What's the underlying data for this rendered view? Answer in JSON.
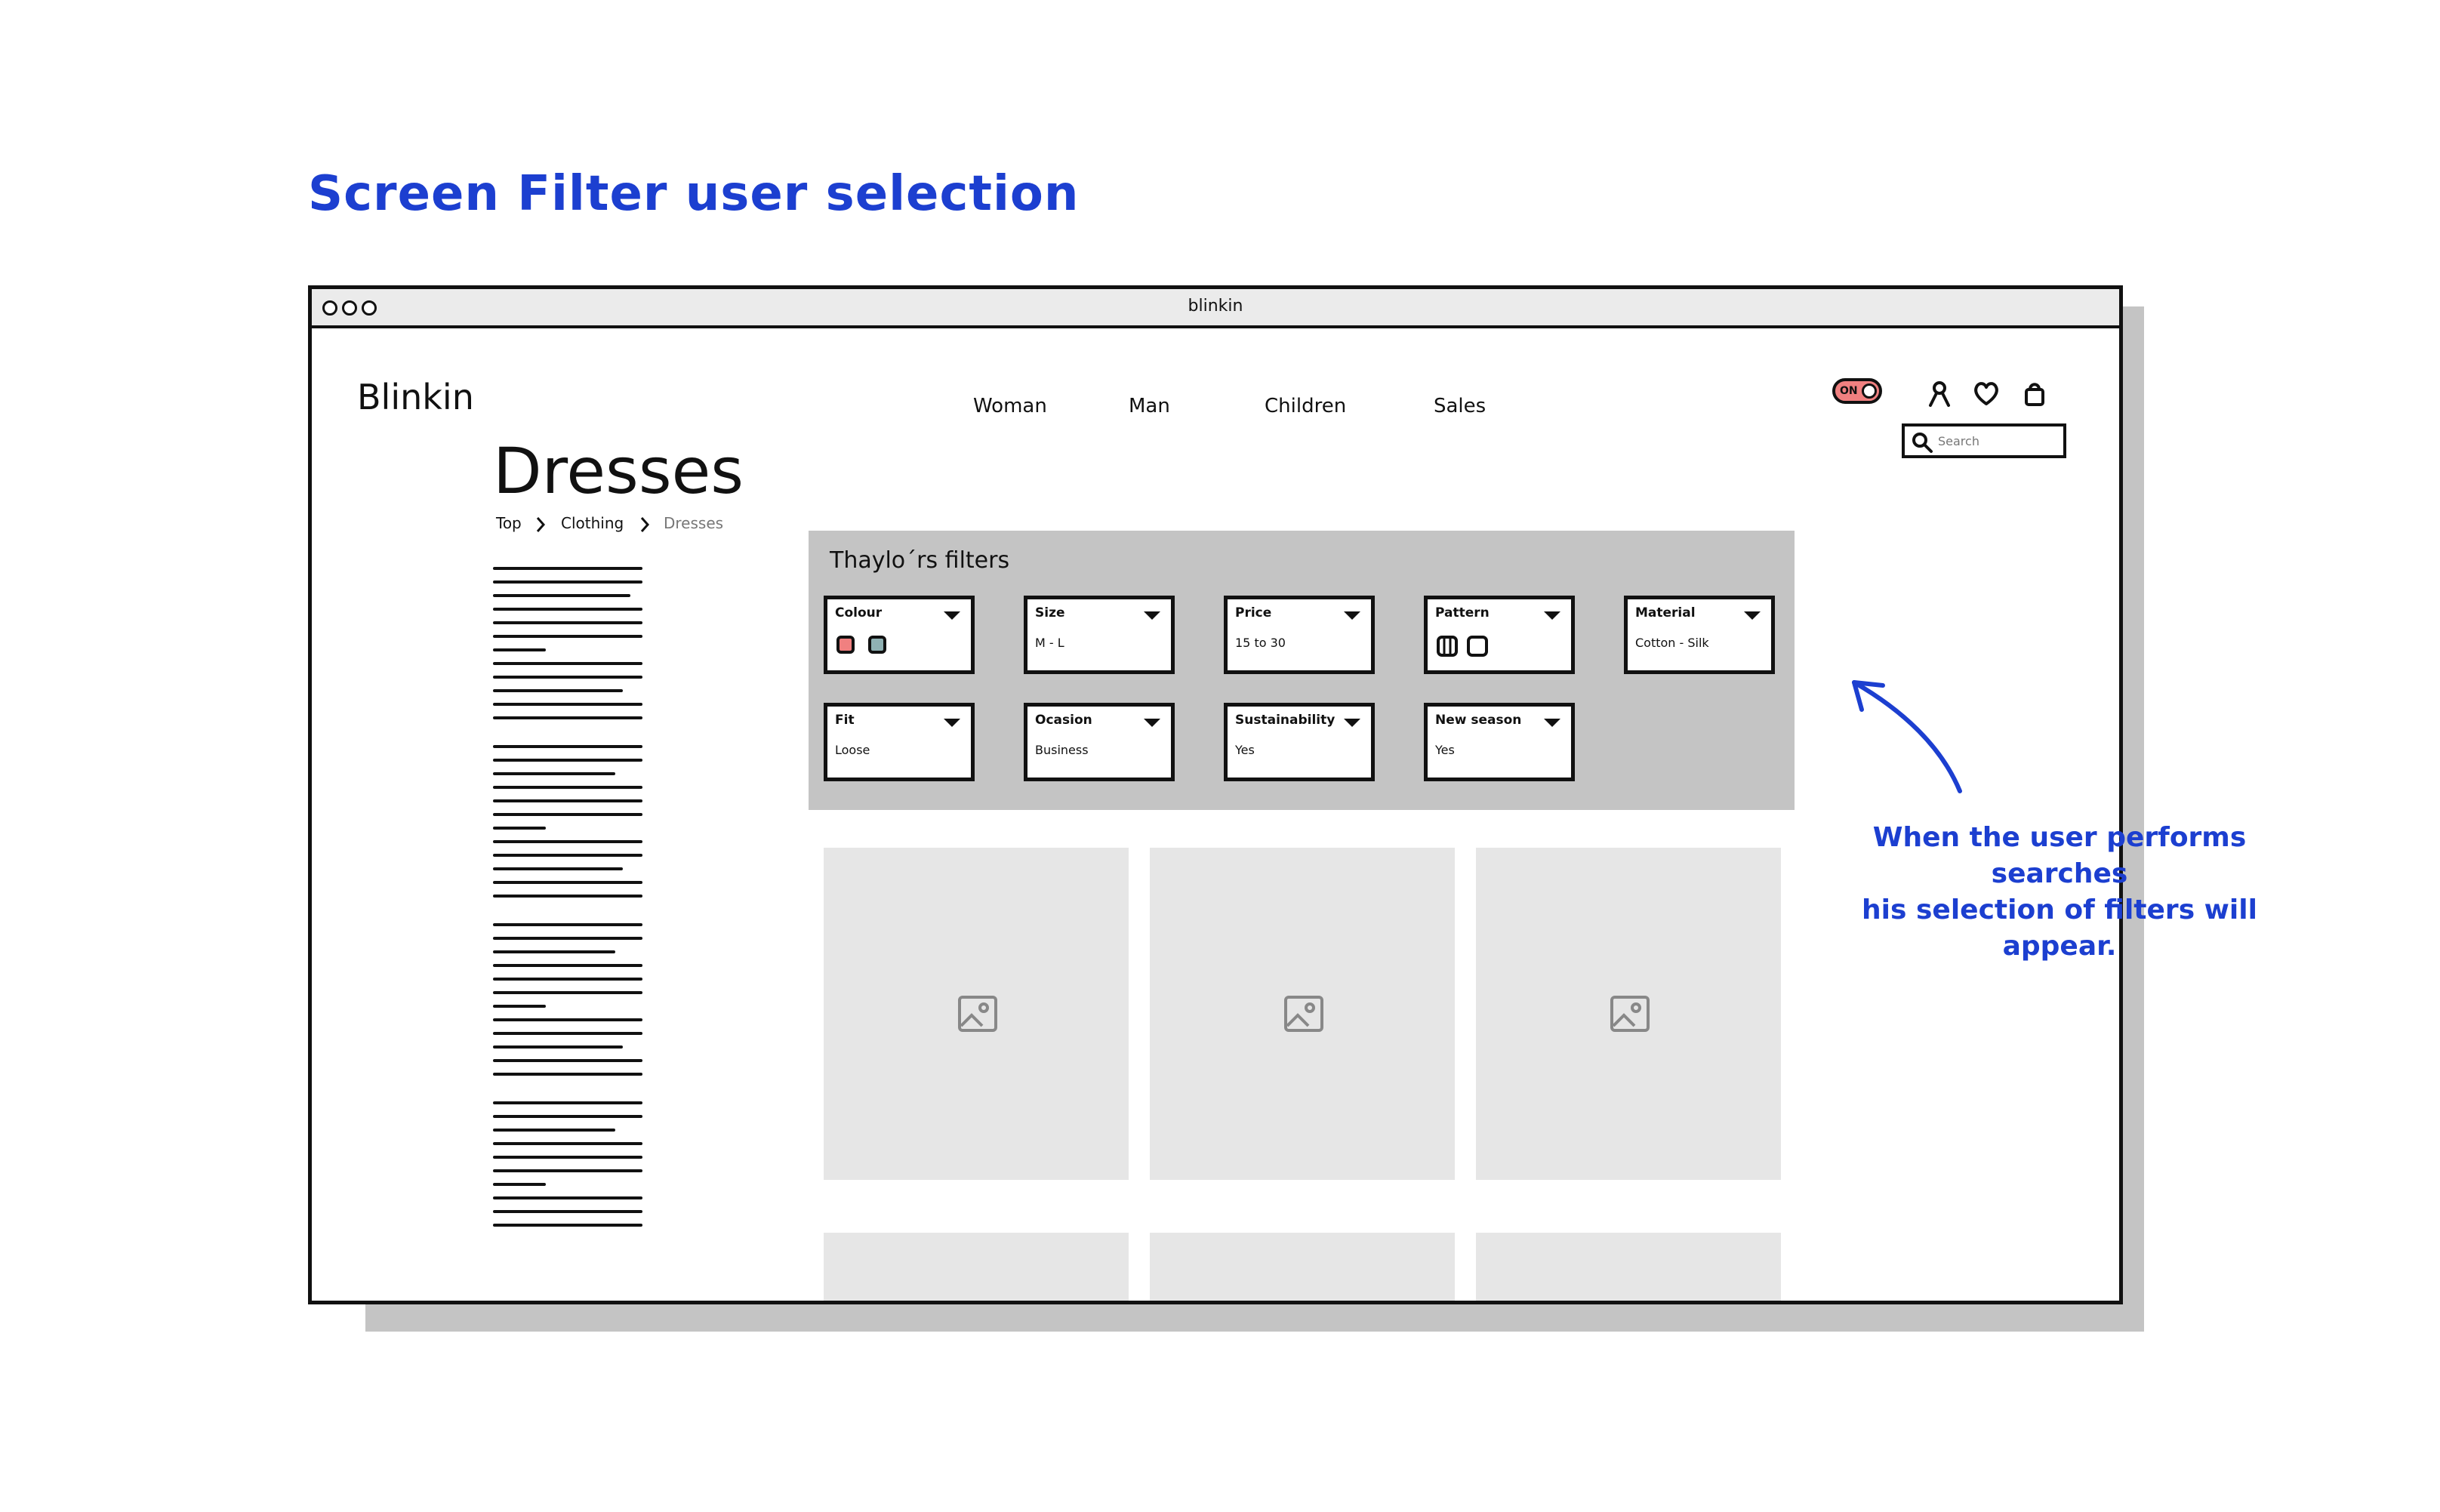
{
  "heading": "Screen Filter user selection",
  "window": {
    "title": "blinkin"
  },
  "header": {
    "brand": "Blinkin",
    "nav": [
      "Woman",
      "Man",
      "Children",
      "Sales"
    ],
    "toggle_label": "ON",
    "icons": [
      "user-icon",
      "heart-icon",
      "bag-icon"
    ],
    "search_placeholder": "Search"
  },
  "page": {
    "title": "Dresses",
    "breadcrumb": [
      "Top",
      "Clothing",
      "Dresses"
    ]
  },
  "filters": {
    "title": "Thaylo´rs filters",
    "items": [
      {
        "label": "Colour",
        "value": "",
        "swatches": [
          "#f08080",
          "#8fb1b3"
        ]
      },
      {
        "label": "Size",
        "value": "M - L"
      },
      {
        "label": "Price",
        "value": "15 to 30"
      },
      {
        "label": "Pattern",
        "value": "",
        "pattern_icons": [
          "striped-pattern-icon",
          "plain-pattern-icon"
        ]
      },
      {
        "label": "Material",
        "value": "Cotton - Silk"
      },
      {
        "label": "Fit",
        "value": "Loose"
      },
      {
        "label": "Ocasion",
        "value": "Business"
      },
      {
        "label": "Sustainability",
        "value": "Yes"
      },
      {
        "label": "New season",
        "value": "Yes"
      }
    ]
  },
  "products": {
    "placeholder_icon": "image-icon"
  },
  "annotation": {
    "line1": "When the user performs searches",
    "line2": "his selection of filters will appear."
  },
  "colors": {
    "accent": "#1c3fd0",
    "toggle_on": "#f08080",
    "panel": "#c4c4c4",
    "placeholder": "#e6e6e6"
  }
}
